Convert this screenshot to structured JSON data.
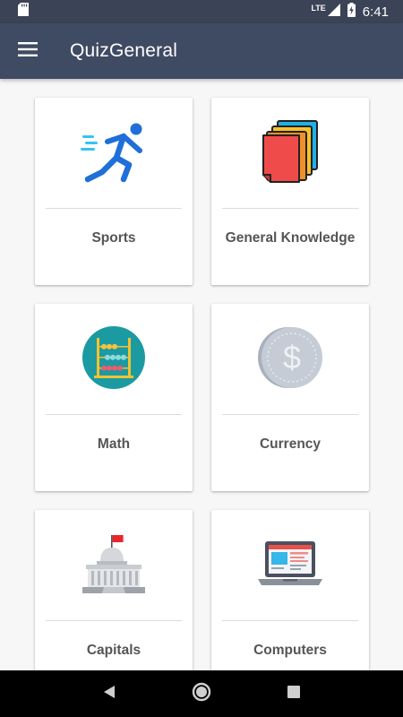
{
  "status_bar": {
    "time": "6:41",
    "network": "LTE",
    "icons": [
      "sd-card-icon",
      "signal-icon",
      "battery-charging-icon"
    ]
  },
  "app_bar": {
    "title": "QuizGeneral",
    "menu_icon": "menu-icon"
  },
  "categories": [
    {
      "label": "Sports",
      "icon": "running-person-icon"
    },
    {
      "label": "General Knowledge",
      "icon": "stacked-notes-icon"
    },
    {
      "label": "Math",
      "icon": "abacus-icon"
    },
    {
      "label": "Currency",
      "icon": "dollar-coin-icon"
    },
    {
      "label": "Capitals",
      "icon": "capitol-building-icon"
    },
    {
      "label": "Computers",
      "icon": "laptop-icon"
    }
  ],
  "nav_bar": {
    "buttons": [
      "back-icon",
      "home-icon",
      "recents-icon"
    ]
  },
  "colors": {
    "app_bar": "#3f4a63",
    "status_bar": "#3b4356",
    "background": "#f7f7f7",
    "card": "#ffffff",
    "label_text": "#555555"
  }
}
